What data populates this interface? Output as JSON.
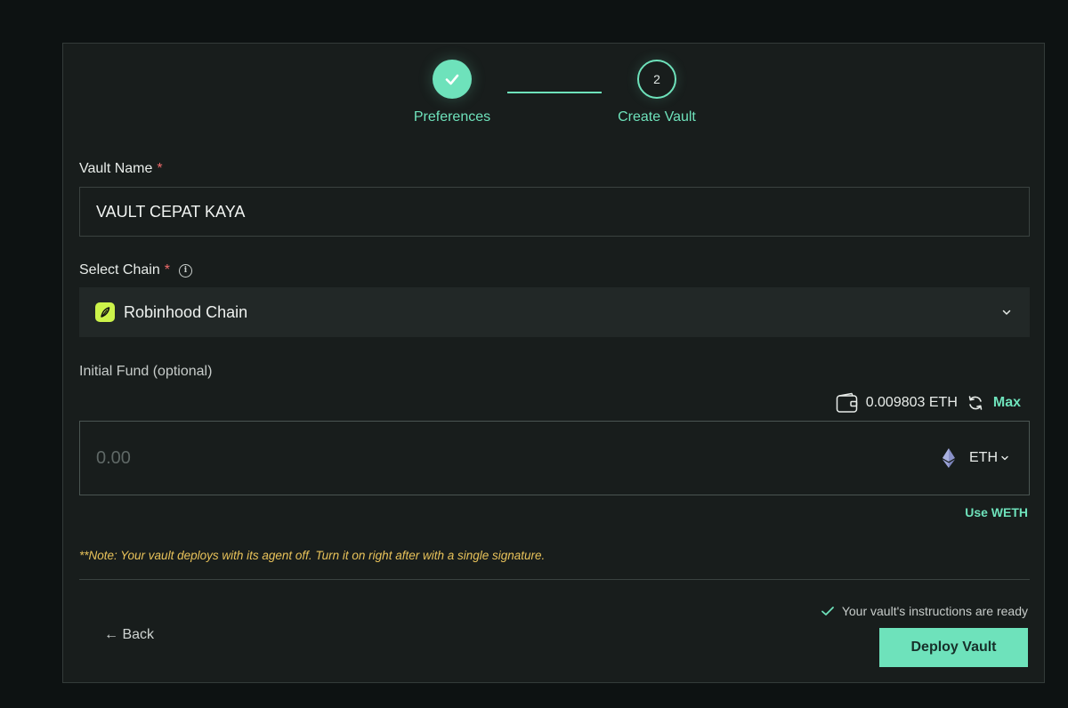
{
  "stepper": {
    "steps": [
      {
        "label": "Preferences",
        "state": "done"
      },
      {
        "label": "Create Vault",
        "number": "2",
        "state": "active"
      }
    ]
  },
  "vault_name": {
    "label": "Vault Name",
    "required_mark": "*",
    "value": "VAULT CEPAT KAYA"
  },
  "chain": {
    "label": "Select Chain",
    "required_mark": "*",
    "info_icon": "info-icon",
    "selected": "Robinhood Chain",
    "logo": "robinhood-feather-icon"
  },
  "fund": {
    "label": "Initial Fund (optional)",
    "balance": "0.009803 ETH",
    "max_label": "Max",
    "placeholder": "0.00",
    "token": "ETH",
    "use_weth_label": "Use WETH"
  },
  "note": "**Note: Your vault deploys with its agent off. Turn it on right after with a single signature.",
  "footer": {
    "back_label": "← Back",
    "ready_message": "Your vault's instructions are ready",
    "deploy_label": "Deploy Vault"
  },
  "colors": {
    "accent": "#6ee2bb",
    "required": "#f06b6b",
    "note": "#e9c35a",
    "chain_logo": "#ccf34a",
    "background": "#0d1212",
    "panel": "#181d1c"
  }
}
